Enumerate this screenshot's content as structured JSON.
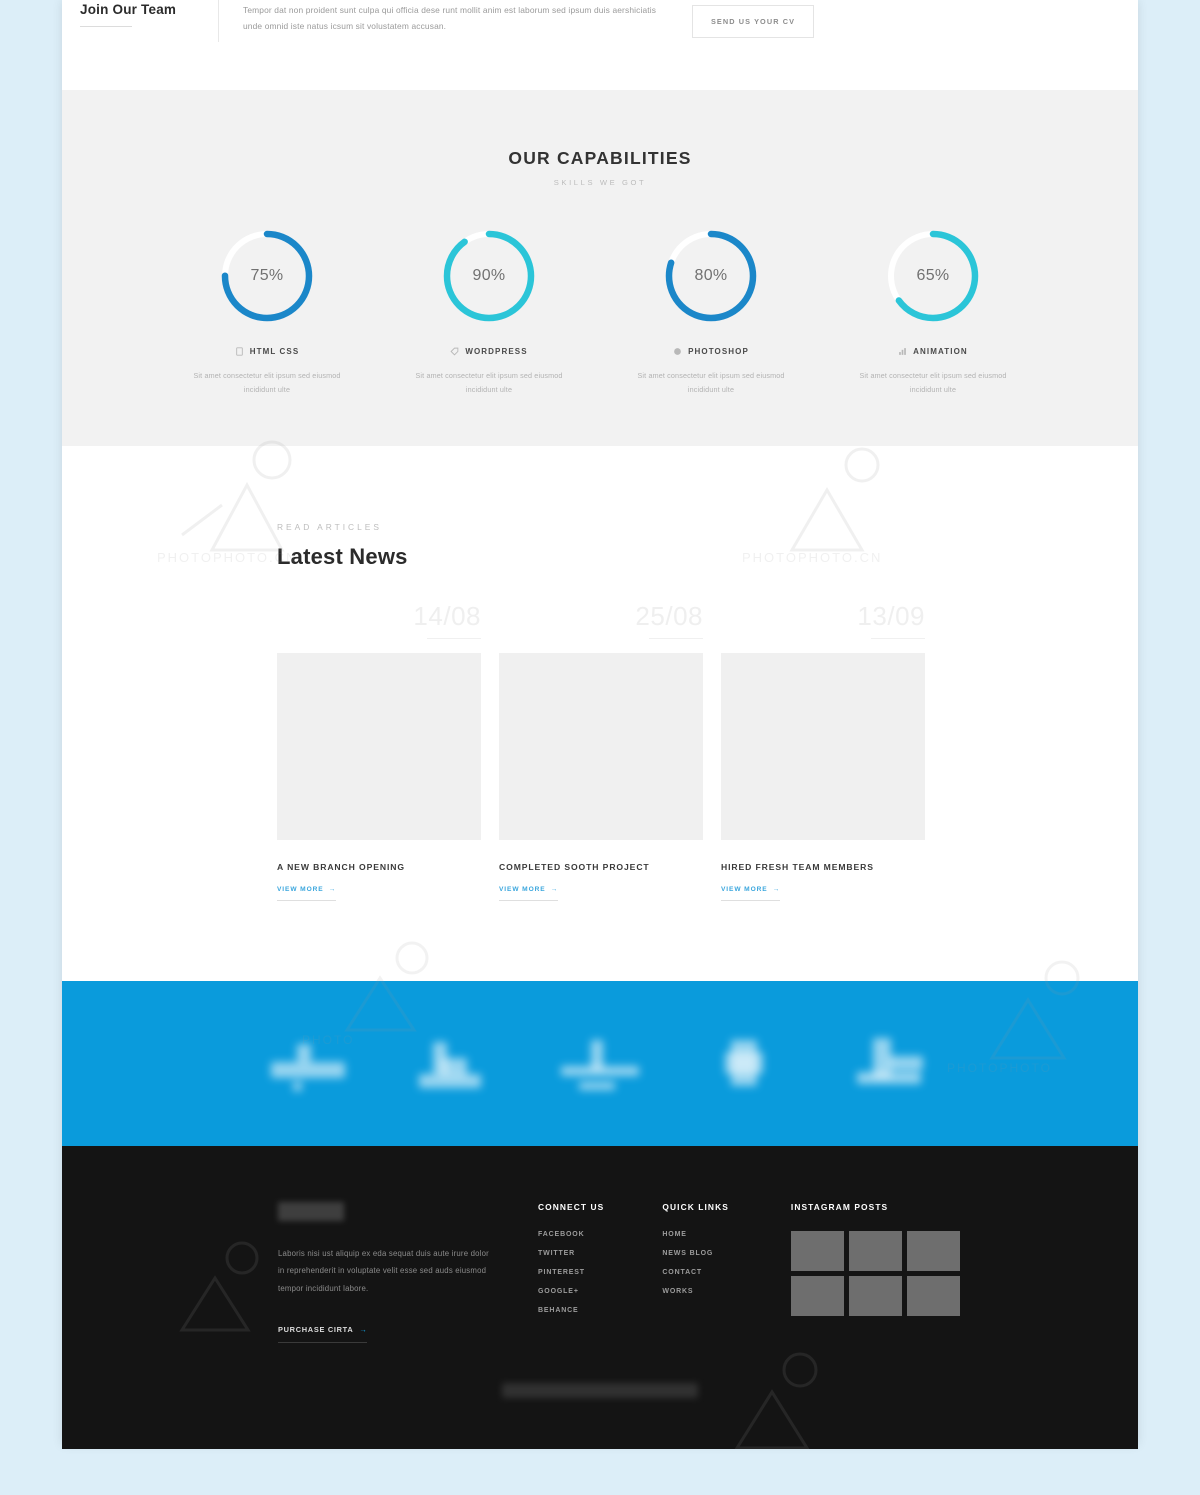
{
  "join": {
    "title": "Join Our Team",
    "body": "Tempor dat non proident sunt culpa qui officia dese runt mollit anim est laborum sed ipsum duis aershiciatis unde omnid iste natus icsum sit volustatem accusan.",
    "cta": "SEND US YOUR CV"
  },
  "capabilities": {
    "title": "OUR CAPABILITIES",
    "subtitle": "SKILLS WE GOT",
    "items": [
      {
        "label": "HTML CSS",
        "value": 75,
        "value_text": "75%",
        "color": "#1b87c9",
        "icon": "file-icon",
        "desc": "Sit amet consectetur elit ipsum sed eiusmod incididunt ulte"
      },
      {
        "label": "WORDPRESS",
        "value": 90,
        "value_text": "90%",
        "color": "#2bc5d8",
        "icon": "tag-icon",
        "desc": "Sit amet consectetur elit ipsum sed eiusmod incididunt ulte"
      },
      {
        "label": "PHOTOSHOP",
        "value": 80,
        "value_text": "80%",
        "color": "#1b87c9",
        "icon": "circle-icon",
        "desc": "Sit amet consectetur elit ipsum sed eiusmod incididunt ulte"
      },
      {
        "label": "ANIMATION",
        "value": 65,
        "value_text": "65%",
        "color": "#2bc5d8",
        "icon": "chart-icon",
        "desc": "Sit amet consectetur elit ipsum sed eiusmod incididunt ulte"
      }
    ]
  },
  "chart_data": {
    "type": "pie",
    "title": "OUR CAPABILITIES",
    "subtitle": "SKILLS WE GOT",
    "categories": [
      "HTML CSS",
      "WORDPRESS",
      "PHOTOSHOP",
      "ANIMATION"
    ],
    "values": [
      75,
      90,
      80,
      65
    ],
    "unit": "%",
    "ylim": [
      0,
      100
    ],
    "colors": [
      "#1b87c9",
      "#2bc5d8",
      "#1b87c9",
      "#2bc5d8"
    ],
    "track_color": "#ffffff",
    "legend": "none",
    "grid": false,
    "note": "Four progress donut rings rendered on a light gray panel; each ring label sits below with a short description."
  },
  "news": {
    "eyebrow": "READ ARTICLES",
    "heading": "Latest News",
    "cards": [
      {
        "date": "14/08",
        "title": "A NEW BRANCH OPENING",
        "more": "VIEW MORE",
        "arrow": "→"
      },
      {
        "date": "25/08",
        "title": "COMPLETED SOOTH PROJECT",
        "more": "VIEW MORE",
        "arrow": "→"
      },
      {
        "date": "13/09",
        "title": "HIRED FRESH TEAM MEMBERS",
        "more": "VIEW MORE",
        "arrow": "→"
      }
    ]
  },
  "clients": {
    "band_color": "#0a9bdc",
    "logos": [
      "client-logo-1",
      "client-logo-2",
      "client-logo-3",
      "client-logo-4",
      "client-logo-5"
    ]
  },
  "footer": {
    "about": {
      "body": "Laboris nisi ust aliquip ex eda sequat duis aute irure dolor in reprehenderit in voluptate velit esse sed auds eiusmod tempor incididunt labore.",
      "purchase": "PURCHASE CIRTA",
      "purchase_arrow": "→"
    },
    "connect": {
      "heading": "CONNECT US",
      "links": [
        "FACEBOOK",
        "TWITTER",
        "PINTEREST",
        "GOOGLE+",
        "BEHANCE"
      ]
    },
    "quick": {
      "heading": "QUICK LINKS",
      "links": [
        "HOME",
        "NEWS BLOG",
        "CONTACT",
        "WORKS"
      ]
    },
    "instagram": {
      "heading": "INSTAGRAM POSTS",
      "count": 6
    }
  }
}
